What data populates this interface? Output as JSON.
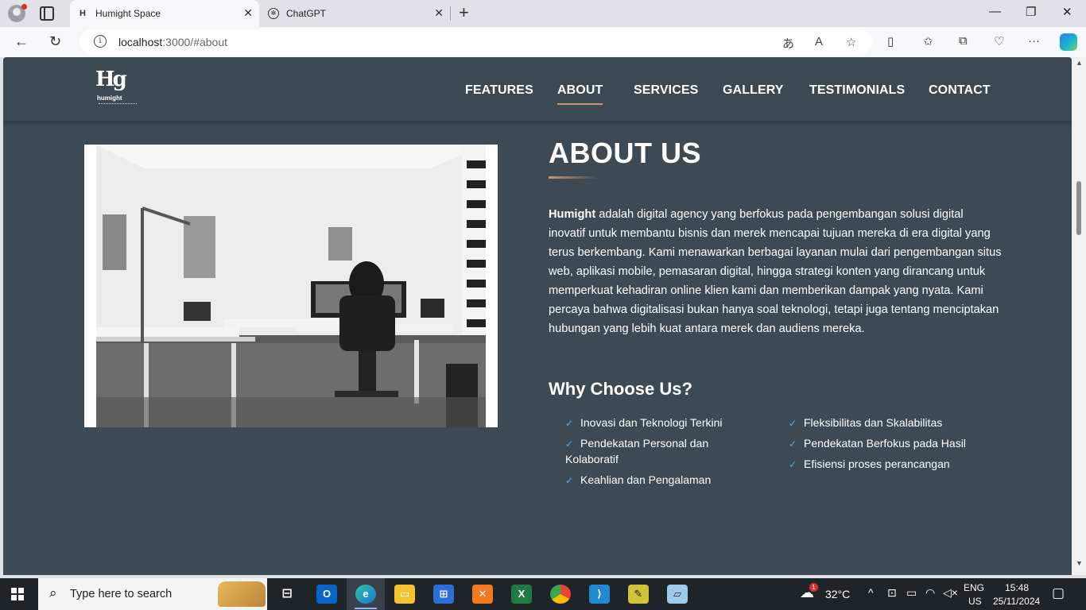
{
  "browser": {
    "tabs": [
      {
        "title": "Humight Space",
        "active": true
      },
      {
        "title": "ChatGPT",
        "active": false
      }
    ],
    "url_host": "localhost",
    "url_rest": ":3000/#about",
    "icons": {
      "read_aloud": "A͡",
      "translate": "अᴬ"
    }
  },
  "site": {
    "logo_mark": "Hg",
    "logo_word": "humight",
    "nav": [
      "FEATURES",
      "ABOUT",
      "SERVICES",
      "GALLERY",
      "TESTIMONIALS",
      "CONTACT"
    ],
    "active_nav": "ABOUT",
    "about": {
      "title": "ABOUT US",
      "brand": "Humight",
      "body": " adalah digital agency yang berfokus pada pengembangan solusi digital inovatif untuk membantu bisnis dan merek mencapai tujuan mereka di era digital yang terus berkembang. Kami menawarkan berbagai layanan mulai dari pengembangan situs web, aplikasi mobile, pemasaran digital, hingga strategi konten yang dirancang untuk memperkuat kehadiran online klien kami dan memberikan dampak yang nyata. Kami percaya bahwa digitalisasi bukan hanya soal teknologi, tetapi juga tentang menciptakan hubungan yang lebih kuat antara merek dan audiens mereka.",
      "why_title": "Why Choose Us?",
      "why_left": [
        "Inovasi dan Teknologi Terkini",
        "Pendekatan Personal dan Kolaboratif",
        "Keahlian dan Pengalaman"
      ],
      "why_right": [
        "Fleksibilitas dan Skalabilitas",
        "Pendekatan Berfokus pada Hasil",
        "Efisiensi proses perancangan"
      ]
    }
  },
  "taskbar": {
    "search_placeholder": "Type here to search",
    "weather_temp": "32°C",
    "weather_badge": "1",
    "lang_top": "ENG",
    "lang_bottom": "US",
    "time": "15:48",
    "date": "25/11/2024"
  },
  "colors": {
    "page_bg": "#3d4a54",
    "accent": "#c49a6c",
    "check": "#5aa8e8"
  }
}
